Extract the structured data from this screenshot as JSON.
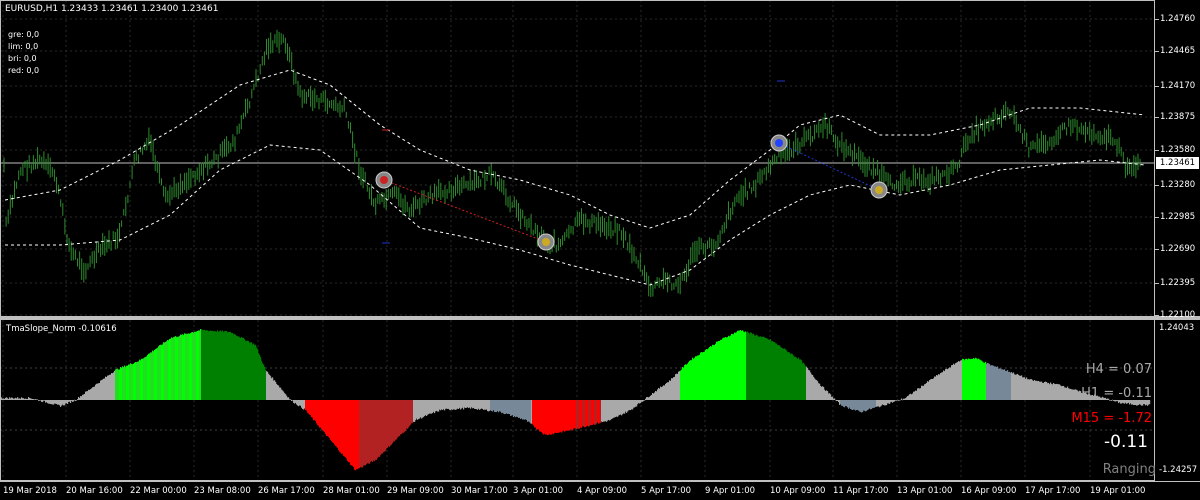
{
  "chart": {
    "symbol_line": "EURUSD,H1  1.23433 1.23461 1.23400 1.23461",
    "info_lines": [
      "gre: 0,0",
      "lim: 0,0",
      "bri: 0,0",
      "red: 0,0"
    ],
    "price_levels": [
      "1.24760",
      "1.24465",
      "1.24170",
      "1.23875",
      "1.23580",
      "1.23280",
      "1.22985",
      "1.22690",
      "1.22395",
      "1.22100"
    ],
    "current_price": "1.23461",
    "colors": {
      "bars": "#2e8b2e",
      "bands": "#ffffff",
      "background": "#000000",
      "axis": "#c0c0c0"
    },
    "markers": [
      "buy-circle",
      "sell-circle",
      "sell-circle",
      "buy-circle",
      "sell-circle"
    ]
  },
  "indicator": {
    "title": "TmaSlope_Norm -0.10616",
    "top_value": "1.24043",
    "bottom_value": "-1.24257",
    "h4": "H4 = 0.07",
    "h1": "H1 = -0.11",
    "m15": "M15 = -1.72",
    "big_value": "-0.11",
    "state": "Ranging",
    "colors": {
      "lime": "#00ff00",
      "green": "#008000",
      "red": "#ff0000",
      "darkred": "#b22222",
      "gray": "#a9a9a9",
      "slate": "#778899"
    }
  },
  "time_axis": [
    "19 Mar 2018",
    "20 Mar 16:00",
    "22 Mar 00:00",
    "23 Mar 08:00",
    "26 Mar 17:00",
    "28 Mar 01:00",
    "29 Mar 09:00",
    "30 Mar 17:00",
    "3 Apr 01:00",
    "4 Apr 09:00",
    "5 Apr 17:00",
    "9 Apr 01:00",
    "10 Apr 09:00",
    "11 Apr 17:00",
    "13 Apr 01:00",
    "16 Apr 09:00",
    "17 Apr 17:00",
    "19 Apr 01:00"
  ]
}
